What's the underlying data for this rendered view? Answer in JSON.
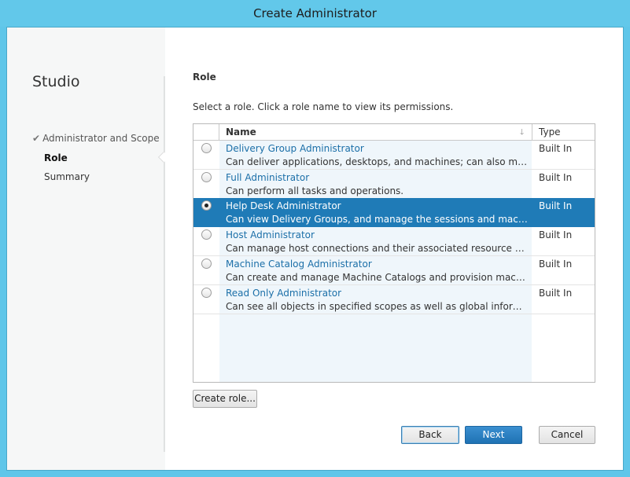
{
  "window": {
    "title": "Create Administrator"
  },
  "sidebar": {
    "title": "Studio",
    "steps": [
      {
        "label": "Administrator and Scope",
        "state": "done"
      },
      {
        "label": "Role",
        "state": "active"
      },
      {
        "label": "Summary",
        "state": "pending"
      }
    ]
  },
  "main": {
    "section_title": "Role",
    "instruction": "Select a role. Click a role name to view its permissions.",
    "grid": {
      "columns": [
        "Name",
        "Type"
      ],
      "sort_icon": "sort-down-arrow-icon",
      "rows": [
        {
          "name": "Delivery Group Administrator",
          "description": "Can deliver applications, desktops, and machines; can also manage the associated sessions.",
          "type": "Built In",
          "selected": false
        },
        {
          "name": "Full Administrator",
          "description": "Can perform all tasks and operations.",
          "type": "Built In",
          "selected": false
        },
        {
          "name": "Help Desk Administrator",
          "description": "Can view Delivery Groups, and manage the sessions and machines associated with those groups.",
          "type": "Built In",
          "selected": true
        },
        {
          "name": "Host Administrator",
          "description": "Can manage host connections and their associated resource settings.",
          "type": "Built In",
          "selected": false
        },
        {
          "name": "Machine Catalog Administrator",
          "description": "Can create and manage Machine Catalogs and provision machines.",
          "type": "Built In",
          "selected": false
        },
        {
          "name": "Read Only Administrator",
          "description": "Can see all objects in specified scopes as well as global information, but cannot change anything.",
          "type": "Built In",
          "selected": false
        }
      ]
    },
    "create_role_label": "Create role..."
  },
  "footer": {
    "back_label": "Back",
    "next_label": "Next",
    "cancel_label": "Cancel"
  },
  "colors": {
    "titlebar": "#62c8ea",
    "selection": "#1f7bb7",
    "link": "#1b6fa8"
  }
}
